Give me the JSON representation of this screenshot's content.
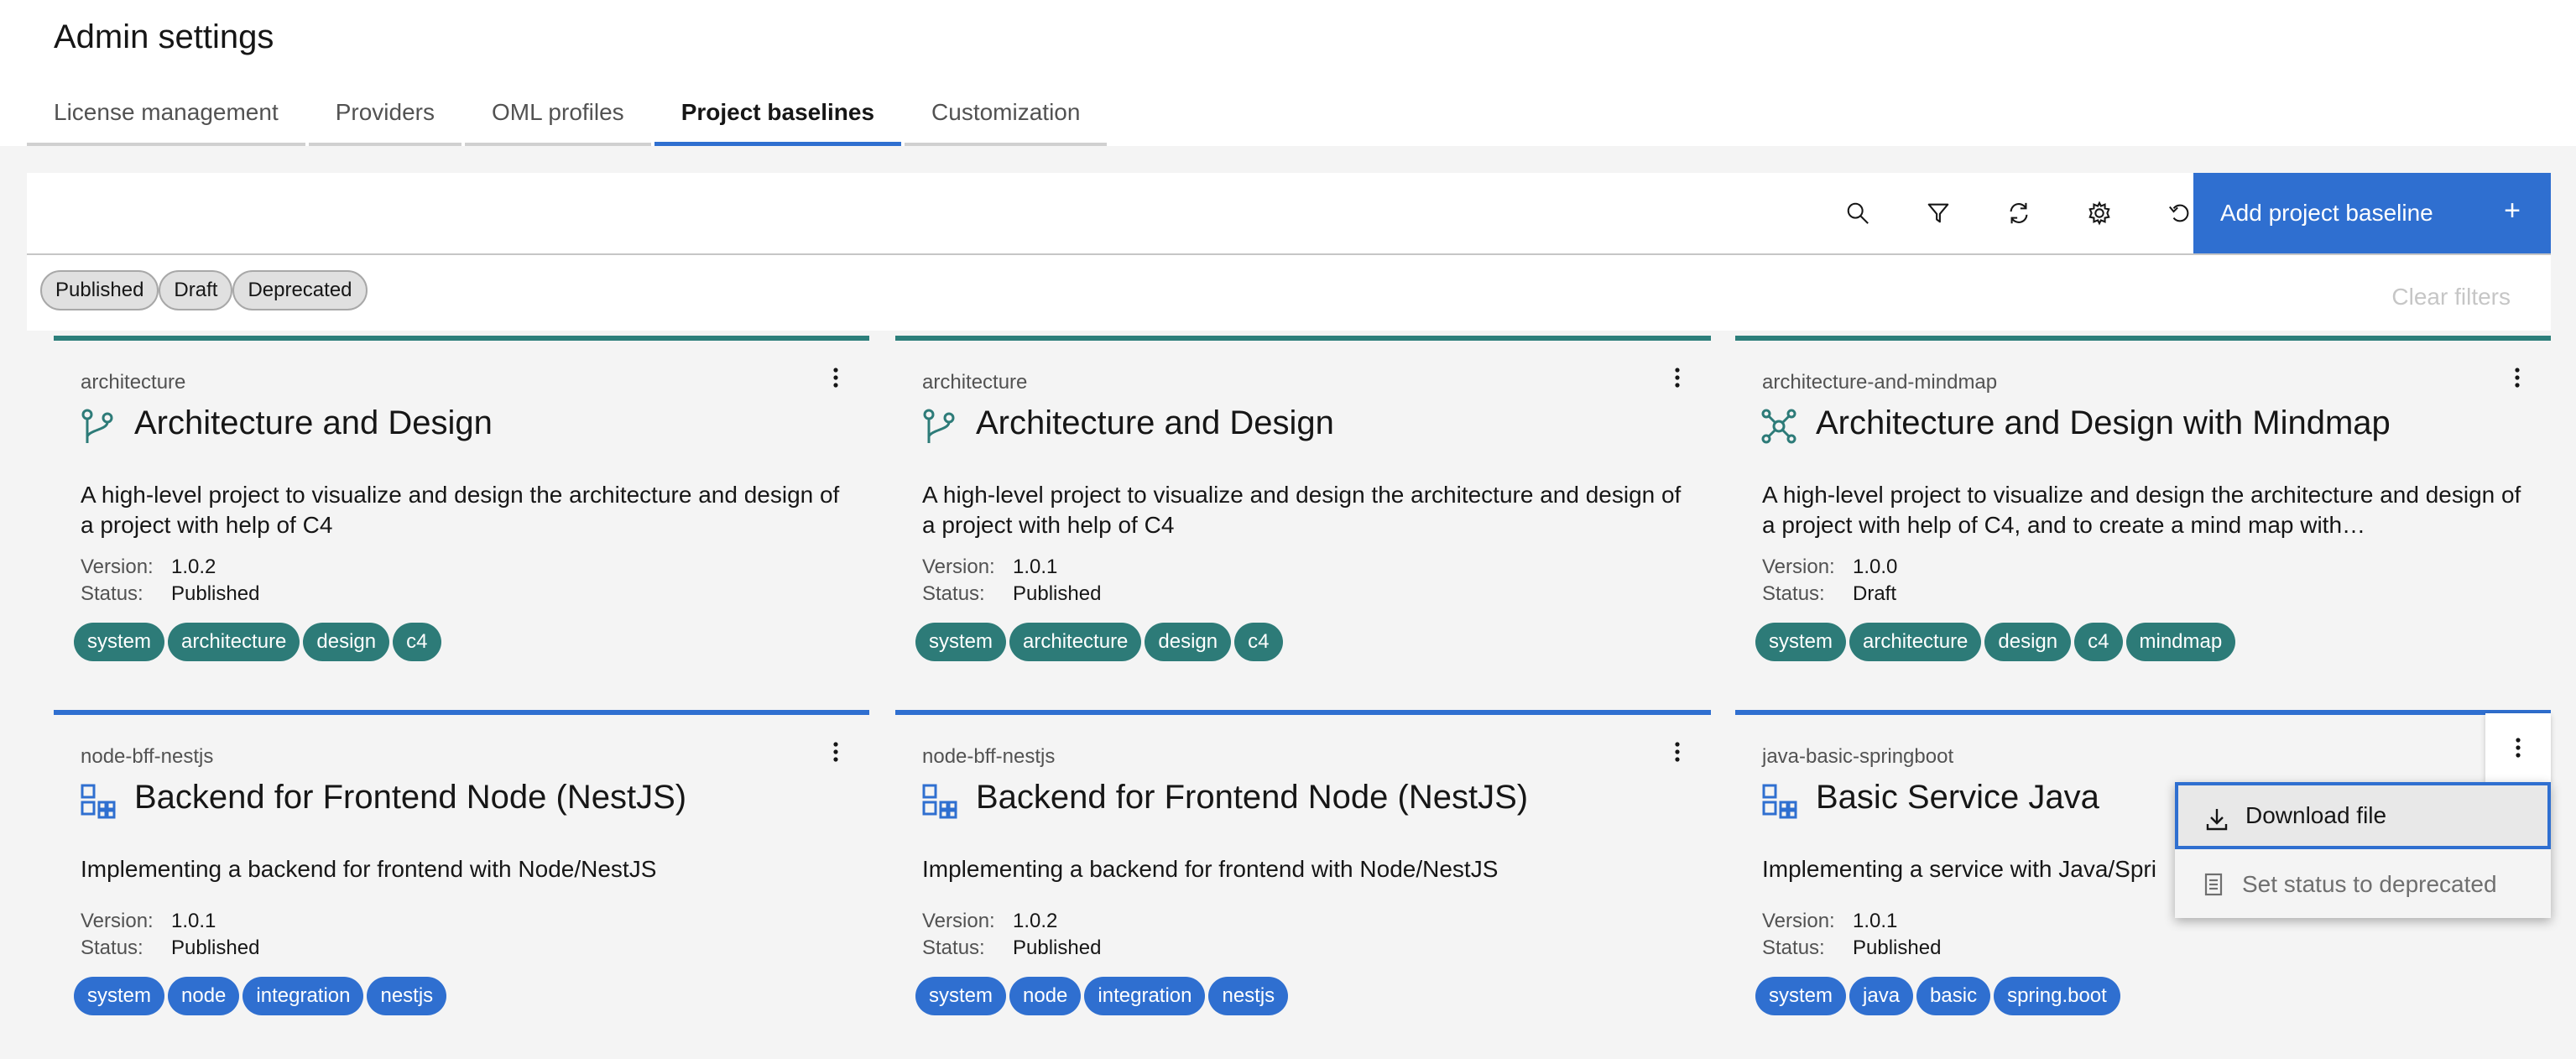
{
  "page_title": "Admin settings",
  "tabs": [
    {
      "label": "License management"
    },
    {
      "label": "Providers"
    },
    {
      "label": "OML profiles"
    },
    {
      "label": "Project baselines"
    },
    {
      "label": "Customization"
    }
  ],
  "active_tab": "Project baselines",
  "toolbar": {
    "icons": [
      "search-icon",
      "filter-icon",
      "refresh-icon",
      "settings-icon",
      "reset-icon"
    ],
    "add_label": "Add project baseline",
    "add_icon": "+"
  },
  "filters": {
    "chips": [
      "Published",
      "Draft",
      "Deprecated"
    ],
    "clear_label": "Clear filters"
  },
  "labels": {
    "version": "Version:",
    "status": "Status:"
  },
  "colors": {
    "accent_blue": "#2f6fd0",
    "teal": "#2d7b78"
  },
  "cards": [
    {
      "category": "architecture",
      "title": "Architecture and Design",
      "icon": "branch-icon",
      "description": "A high-level project to visualize and design the architecture and design of a project with help of C4",
      "version": "1.0.2",
      "status": "Published",
      "tags": [
        "system",
        "architecture",
        "design",
        "c4"
      ]
    },
    {
      "category": "architecture",
      "title": "Architecture and Design",
      "icon": "branch-icon",
      "description": "A high-level project to visualize and design the architecture and design of a project with help of C4",
      "version": "1.0.1",
      "status": "Published",
      "tags": [
        "system",
        "architecture",
        "design",
        "c4"
      ]
    },
    {
      "category": "architecture-and-mindmap",
      "title": "Architecture and Design with Mindmap",
      "icon": "mindmap-icon",
      "description": "A high-level project to visualize and design the architecture and design of a project with help of C4, and to create a mind map with…",
      "version": "1.0.0",
      "status": "Draft",
      "tags": [
        "system",
        "architecture",
        "design",
        "c4",
        "mindmap"
      ]
    },
    {
      "category": "node-bff-nestjs",
      "title": "Backend for Frontend Node (NestJS)",
      "icon": "service-icon",
      "description": "Implementing a backend for frontend with Node/NestJS",
      "version": "1.0.1",
      "status": "Published",
      "tags": [
        "system",
        "node",
        "integration",
        "nestjs"
      ]
    },
    {
      "category": "node-bff-nestjs",
      "title": "Backend for Frontend Node (NestJS)",
      "icon": "service-icon",
      "description": "Implementing a backend for frontend with Node/NestJS",
      "version": "1.0.2",
      "status": "Published",
      "tags": [
        "system",
        "node",
        "integration",
        "nestjs"
      ]
    },
    {
      "category": "java-basic-springboot",
      "title": "Basic Service Java",
      "icon": "service-icon",
      "description": "Implementing a service with Java/Spri",
      "version": "1.0.1",
      "status": "Published",
      "tags": [
        "system",
        "java",
        "basic",
        "spring.boot"
      ]
    }
  ],
  "context_menu": {
    "items": [
      {
        "label": "Download file",
        "icon": "download-icon"
      },
      {
        "label": "Set status to deprecated",
        "icon": "document-icon"
      }
    ]
  }
}
